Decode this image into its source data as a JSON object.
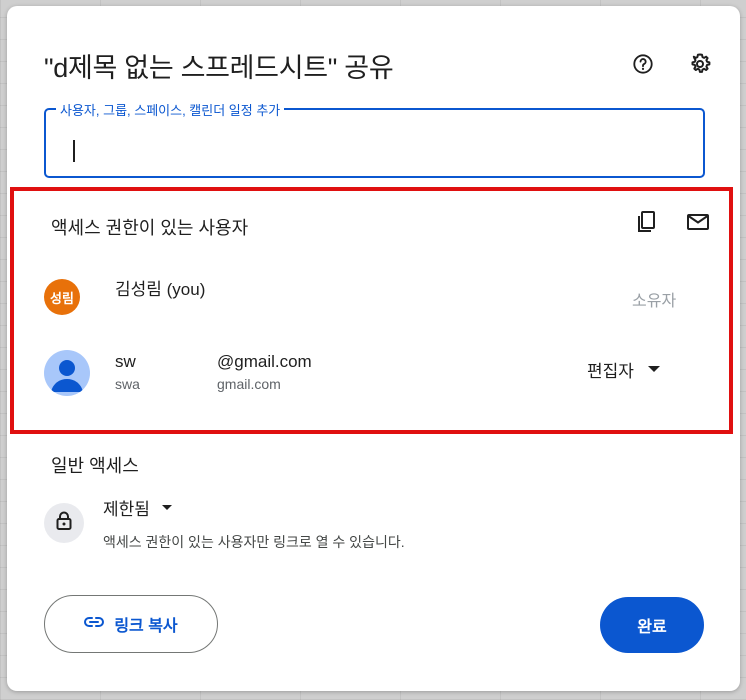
{
  "dialog": {
    "title": "\"d제목 없는 스프레드시트\" 공유",
    "help_icon": "help-circle-icon",
    "settings_icon": "gear-icon"
  },
  "add_people": {
    "label": "사용자, 그룹, 스페이스, 캘린더 일정 추가",
    "value": ""
  },
  "people_with_access": {
    "heading": "액세스 권한이 있는 사용자",
    "copy_icon": "copy-icon",
    "email_icon": "mail-icon",
    "people": [
      {
        "avatar_text": "성림",
        "avatar_color": "#e8710a",
        "name": "김성림 (you)",
        "email": "",
        "role": "소유자"
      },
      {
        "avatar_text": "",
        "avatar_color": "#a8c7fa",
        "name_prefix": "sw",
        "name_suffix": "@gmail.com",
        "email_prefix": "swa",
        "email_suffix": "gmail.com",
        "role": "편집자"
      }
    ]
  },
  "general_access": {
    "heading": "일반 액세스",
    "mode": "제한됨",
    "description": "액세스 권한이 있는 사용자만 링크로 열 수 있습니다.",
    "icon": "lock-icon"
  },
  "footer": {
    "copy_link_label": "링크 복사",
    "copy_link_icon": "link-icon",
    "done_label": "완료"
  },
  "colors": {
    "accent": "#0b57d0",
    "highlight_border": "#e01010"
  }
}
